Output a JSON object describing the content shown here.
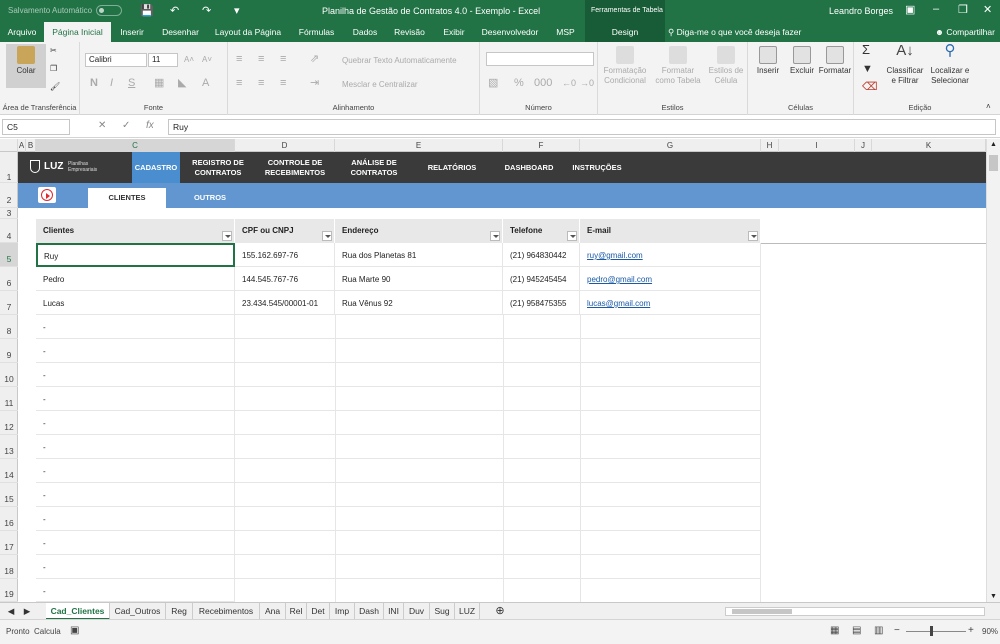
{
  "titlebar": {
    "autosave": "Salvamento Automático",
    "title": "Planilha de Gestão de Contratos 4.0 - Exemplo  -  Excel",
    "tools": "Ferramentas de Tabela",
    "user": "Leandro Borges"
  },
  "ribbon_tabs": [
    "Arquivo",
    "Página Inicial",
    "Inserir",
    "Desenhar",
    "Layout da Página",
    "Fórmulas",
    "Dados",
    "Revisão",
    "Exibir",
    "Desenvolvedor",
    "MSP",
    "Design"
  ],
  "tellme": "Diga-me o que você deseja fazer",
  "share": "Compartilhar",
  "ribbon": {
    "paste": "Colar",
    "clipboard": "Área de Transferência",
    "font_name": "Calibri",
    "font_size": "11",
    "font_group": "Fonte",
    "wrap_text": "Quebrar Texto Automaticamente",
    "merge_center": "Mesclar e Centralizar",
    "alignment": "Alinhamento",
    "number": "Número",
    "cond_format": "Formatação Condicional",
    "format_table": "Formatar como Tabela",
    "cell_styles": "Estilos de Célula",
    "styles": "Estilos",
    "insert": "Inserir",
    "delete": "Excluir",
    "format": "Formatar",
    "cells": "Células",
    "sort_filter": "Classificar e Filtrar",
    "find_select": "Localizar e Selecionar",
    "editing": "Edição"
  },
  "formula_bar": {
    "cell_ref": "C5",
    "value": "Ruy"
  },
  "columns": [
    "A",
    "B",
    "C",
    "D",
    "E",
    "F",
    "G",
    "H",
    "I",
    "J",
    "K"
  ],
  "rows": [
    "1",
    "2",
    "3",
    "4",
    "5",
    "6",
    "7",
    "8",
    "9",
    "10",
    "11",
    "12",
    "13",
    "14",
    "15",
    "16",
    "17",
    "18",
    "19"
  ],
  "nav": {
    "logo": "LUZ",
    "logo_sub": "Planilhas Empresariais",
    "items": [
      "CADASTRO",
      "REGISTRO DE CONTRATOS",
      "CONTROLE DE RECEBIMENTOS",
      "ANÁLISE DE CONTRATOS",
      "RELATÓRIOS",
      "DASHBOARD",
      "INSTRUÇÕES"
    ]
  },
  "subtabs": [
    "CLIENTES",
    "OUTROS"
  ],
  "table": {
    "headers": [
      "Clientes",
      "CPF ou CNPJ",
      "Endereço",
      "Telefone",
      "E-mail"
    ],
    "rows": [
      [
        "Ruy",
        "155.162.697-76",
        "Rua dos Planetas 81",
        "(21) 964830442",
        "ruy@gmail.com"
      ],
      [
        "Pedro",
        "144.545.767-76",
        "Rua Marte 90",
        "(21) 945245454",
        "pedro@gmail.com"
      ],
      [
        "Lucas",
        "23.434.545/00001-01",
        "Rua Vênus 92",
        "(21) 958475355",
        "lucas@gmail.com"
      ]
    ],
    "empty_marker": "-"
  },
  "sheet_tabs": [
    "Cad_Clientes",
    "Cad_Outros",
    "Reg",
    "Recebimentos",
    "Ana",
    "Rel",
    "Det",
    "Imp",
    "Dash",
    "INI",
    "Duv",
    "Sug",
    "LUZ"
  ],
  "status": {
    "ready": "Pronto",
    "calc": "Calcula",
    "zoom": "90%"
  }
}
